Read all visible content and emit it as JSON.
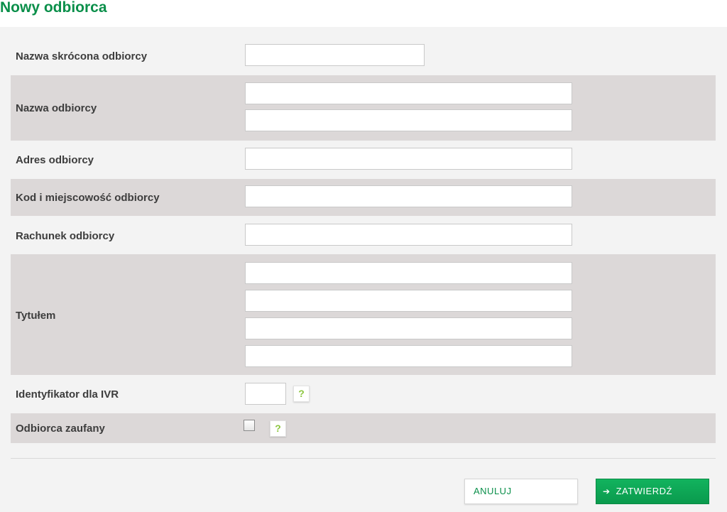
{
  "page": {
    "title": "Nowy odbiorca"
  },
  "form": {
    "short_name": {
      "label": "Nazwa skrócona odbiorcy",
      "value": ""
    },
    "name": {
      "label": "Nazwa odbiorcy",
      "line1": "",
      "line2": ""
    },
    "address": {
      "label": "Adres odbiorcy",
      "value": ""
    },
    "postal_city": {
      "label": "Kod i miejscowość odbiorcy",
      "value": ""
    },
    "account": {
      "label": "Rachunek odbiorcy",
      "value": ""
    },
    "title": {
      "label": "Tytułem",
      "line1": "",
      "line2": "",
      "line3": "",
      "line4": ""
    },
    "ivr_id": {
      "label": "Identyfikator dla IVR",
      "value": "",
      "help": "?"
    },
    "trusted": {
      "label": "Odbiorca zaufany",
      "checked": false,
      "help": "?"
    }
  },
  "actions": {
    "cancel_label": "ANULUJ",
    "confirm_label": "ZATWIERDŹ",
    "confirm_icon": "arrow-right-icon"
  },
  "colors": {
    "accent": "#0a8f4a",
    "help_icon": "#8cc63f",
    "row_shade": "#dcd8d8",
    "panel_bg": "#f3f3f3"
  }
}
